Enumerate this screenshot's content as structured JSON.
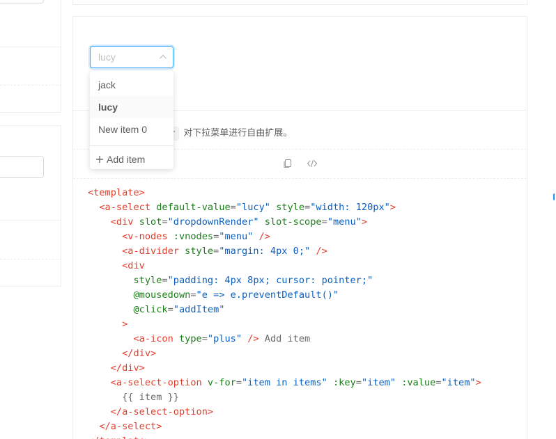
{
  "select": {
    "value": "lucy",
    "options": [
      "jack",
      "lucy",
      "New item 0"
    ],
    "selected_index": 1,
    "add_item_label": "Add item"
  },
  "description": {
    "code": "r",
    "text": "对下拉菜单进行自由扩展。"
  },
  "icons": {
    "copy": "copy-icon",
    "code": "code-icon",
    "plus": "plus-icon",
    "arrow": "chevron-up-icon"
  },
  "code_lines": [
    [
      [
        "t",
        "<template>"
      ]
    ],
    [
      [
        "p",
        "  "
      ],
      [
        "t",
        "<a-select"
      ],
      [
        "p",
        " "
      ],
      [
        "a",
        "default-value"
      ],
      [
        "p",
        "="
      ],
      [
        "s",
        "\"lucy\""
      ],
      [
        "p",
        " "
      ],
      [
        "a",
        "style"
      ],
      [
        "p",
        "="
      ],
      [
        "s",
        "\"width: 120px\""
      ],
      [
        "t",
        ">"
      ]
    ],
    [
      [
        "p",
        "    "
      ],
      [
        "t",
        "<div"
      ],
      [
        "p",
        " "
      ],
      [
        "a",
        "slot"
      ],
      [
        "p",
        "="
      ],
      [
        "s",
        "\"dropdownRender\""
      ],
      [
        "p",
        " "
      ],
      [
        "a",
        "slot-scope"
      ],
      [
        "p",
        "="
      ],
      [
        "s",
        "\"menu\""
      ],
      [
        "t",
        ">"
      ]
    ],
    [
      [
        "p",
        "      "
      ],
      [
        "t",
        "<v-nodes"
      ],
      [
        "p",
        " "
      ],
      [
        "a",
        ":vnodes"
      ],
      [
        "p",
        "="
      ],
      [
        "s",
        "\"menu\""
      ],
      [
        "p",
        " "
      ],
      [
        "t",
        "/>"
      ]
    ],
    [
      [
        "p",
        "      "
      ],
      [
        "t",
        "<a-divider"
      ],
      [
        "p",
        " "
      ],
      [
        "a",
        "style"
      ],
      [
        "p",
        "="
      ],
      [
        "s",
        "\"margin: 4px 0;\""
      ],
      [
        "p",
        " "
      ],
      [
        "t",
        "/>"
      ]
    ],
    [
      [
        "p",
        "      "
      ],
      [
        "t",
        "<div"
      ]
    ],
    [
      [
        "p",
        "        "
      ],
      [
        "a",
        "style"
      ],
      [
        "p",
        "="
      ],
      [
        "s",
        "\"padding: 4px 8px; cursor: pointer;\""
      ]
    ],
    [
      [
        "p",
        "        "
      ],
      [
        "a",
        "@mousedown"
      ],
      [
        "p",
        "="
      ],
      [
        "s",
        "\"e => e.preventDefault()\""
      ]
    ],
    [
      [
        "p",
        "        "
      ],
      [
        "a",
        "@click"
      ],
      [
        "p",
        "="
      ],
      [
        "s",
        "\"addItem\""
      ]
    ],
    [
      [
        "p",
        "      "
      ],
      [
        "t",
        ">"
      ]
    ],
    [
      [
        "p",
        "        "
      ],
      [
        "t",
        "<a-icon"
      ],
      [
        "p",
        " "
      ],
      [
        "a",
        "type"
      ],
      [
        "p",
        "="
      ],
      [
        "s",
        "\"plus\""
      ],
      [
        "p",
        " "
      ],
      [
        "t",
        "/>"
      ],
      [
        "p",
        " Add item"
      ]
    ],
    [
      [
        "p",
        "      "
      ],
      [
        "t",
        "</div>"
      ]
    ],
    [
      [
        "p",
        "    "
      ],
      [
        "t",
        "</div>"
      ]
    ],
    [
      [
        "p",
        "    "
      ],
      [
        "t",
        "<a-select-option"
      ],
      [
        "p",
        " "
      ],
      [
        "a",
        "v-for"
      ],
      [
        "p",
        "="
      ],
      [
        "s",
        "\"item in items\""
      ],
      [
        "p",
        " "
      ],
      [
        "a",
        ":key"
      ],
      [
        "p",
        "="
      ],
      [
        "s",
        "\"item\""
      ],
      [
        "p",
        " "
      ],
      [
        "a",
        ":value"
      ],
      [
        "p",
        "="
      ],
      [
        "s",
        "\"item\""
      ],
      [
        "t",
        ">"
      ]
    ],
    [
      [
        "p",
        "      {{ item }}"
      ]
    ],
    [
      [
        "p",
        "    "
      ],
      [
        "t",
        "</a-select-option>"
      ]
    ],
    [
      [
        "p",
        "  "
      ],
      [
        "t",
        "</a-select>"
      ]
    ],
    [
      [
        "t",
        "</template>"
      ]
    ]
  ],
  "colors": {
    "tag": "#e03e2d",
    "attr": "#1a7d1a",
    "string": "#0b5fc1",
    "focus_border": "#40a9ff"
  }
}
